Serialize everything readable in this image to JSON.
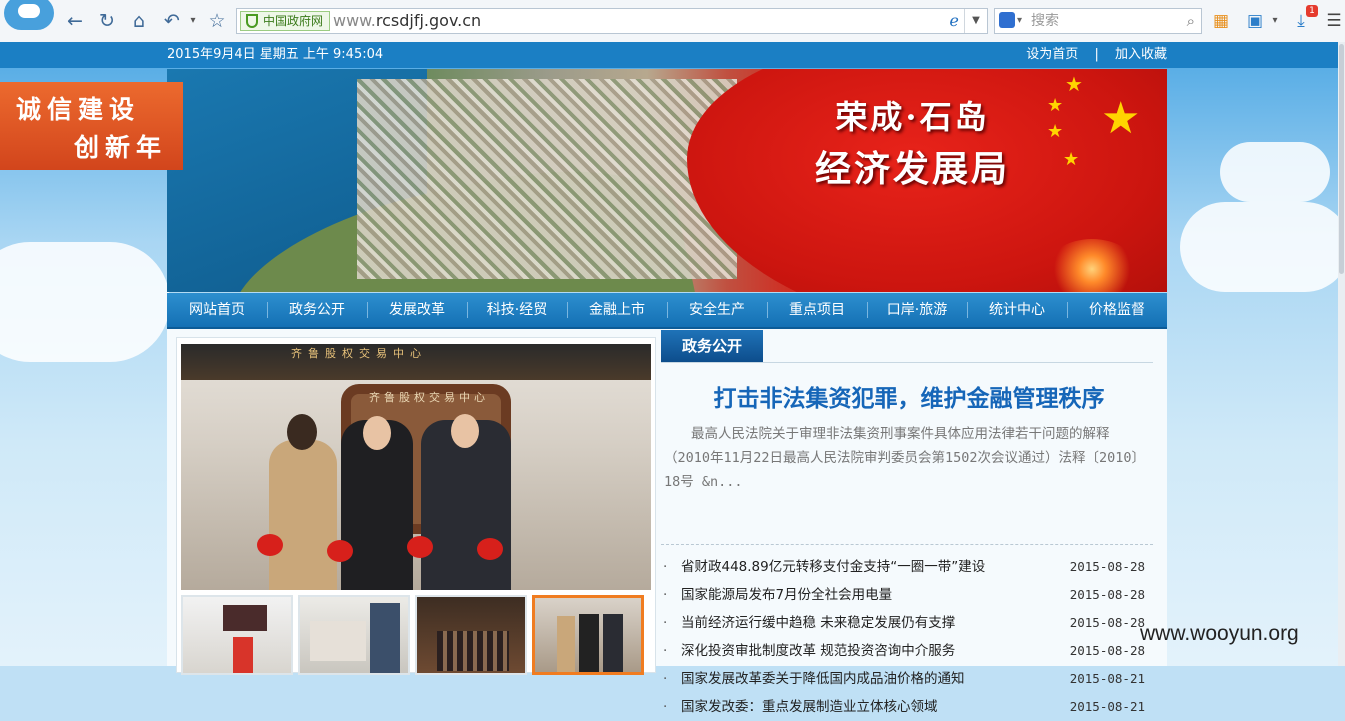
{
  "browser": {
    "gov_badge": "中国政府网",
    "url_prefix": "www.",
    "url_domain": "rcsdjfj.gov.cn",
    "search_placeholder": "搜索",
    "download_count": "1"
  },
  "topbar": {
    "date": "2015年9月4日 星期五 上午 9:45:04",
    "set_home": "设为首页",
    "separator": "|",
    "add_favorite": "加入收藏"
  },
  "promo": {
    "line1": "诚信建设",
    "line2": "创新年"
  },
  "banner": {
    "title_line1": "荣成·石岛",
    "title_line2": "经济发展局"
  },
  "nav": [
    "网站首页",
    "政务公开",
    "发展改革",
    "科技·经贸",
    "金融上市",
    "安全生产",
    "重点项目",
    "口岸·旅游",
    "统计中心",
    "价格监督"
  ],
  "photo": {
    "screen_text": "齐鲁股权交易中心",
    "stand_text": "齐鲁股权交易中心"
  },
  "section": {
    "tab": "政务公开",
    "headline": "打击非法集资犯罪，维护金融管理秩序",
    "summary": "最高人民法院关于审理非法集资刑事案件具体应用法律若干问题的解释（2010年11月22日最高人民法院审判委员会第1502次会议通过）法释〔2010〕18号 &n..."
  },
  "news": [
    {
      "title": "省财政448.89亿元转移支付金支持“一圈一带”建设",
      "date": "2015-08-28"
    },
    {
      "title": "国家能源局发布7月份全社会用电量",
      "date": "2015-08-28"
    },
    {
      "title": "当前经济运行缓中趋稳 未来稳定发展仍有支撑",
      "date": "2015-08-28"
    },
    {
      "title": "深化投资审批制度改革 规范投资咨询中介服务",
      "date": "2015-08-28"
    },
    {
      "title": "国家发展改革委关于降低国内成品油价格的通知",
      "date": "2015-08-21"
    },
    {
      "title": "国家发改委：重点发展制造业立体核心领域",
      "date": "2015-08-21"
    }
  ],
  "watermark": "www.wooyun.org",
  "colors": {
    "accent": "#1b7fc4",
    "headline": "#1666b8",
    "promo": "#e25a25",
    "flag_red": "#d81a12"
  }
}
